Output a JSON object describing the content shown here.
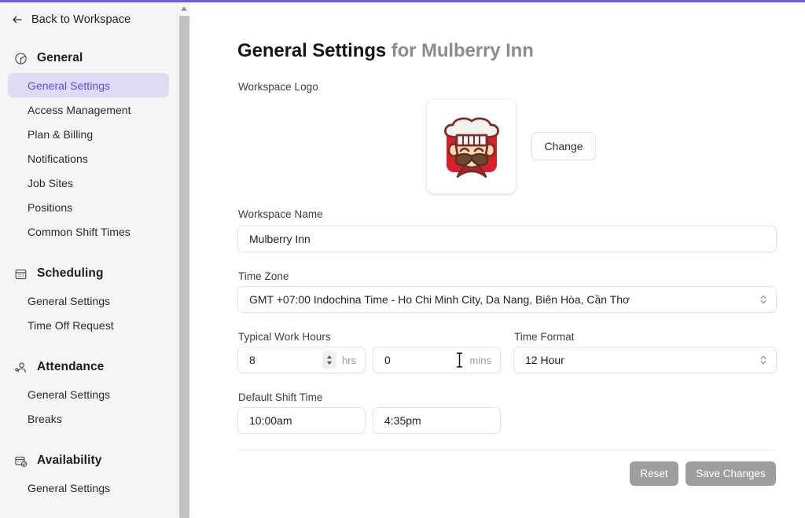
{
  "accent_color": "#6c5ce7",
  "sidebar": {
    "back": {
      "label": "Back to Workspace",
      "icon": "arrow-left-icon"
    },
    "groups": [
      {
        "title": "General",
        "icon": "compass-icon",
        "items": [
          {
            "label": "General Settings",
            "active": true
          },
          {
            "label": "Access Management",
            "active": false
          },
          {
            "label": "Plan & Billing",
            "active": false
          },
          {
            "label": "Notifications",
            "active": false
          },
          {
            "label": "Job Sites",
            "active": false
          },
          {
            "label": "Positions",
            "active": false
          },
          {
            "label": "Common Shift Times",
            "active": false
          }
        ]
      },
      {
        "title": "Scheduling",
        "icon": "calendar-icon",
        "items": [
          {
            "label": "General Settings",
            "active": false
          },
          {
            "label": "Time Off Request",
            "active": false
          }
        ]
      },
      {
        "title": "Attendance",
        "icon": "user-check-icon",
        "items": [
          {
            "label": "General Settings",
            "active": false
          },
          {
            "label": "Breaks",
            "active": false
          }
        ]
      },
      {
        "title": "Availability",
        "icon": "calendar-check-icon",
        "items": [
          {
            "label": "General Settings",
            "active": false
          }
        ]
      }
    ],
    "scrollbar": {
      "up_arrow_icon": "caret-up-icon"
    }
  },
  "main": {
    "title_primary": "General Settings",
    "title_secondary": "for Mulberry Inn",
    "logo": {
      "label": "Workspace Logo",
      "alt": "chef-mascot-logo",
      "change_button": "Change",
      "colors": {
        "background": "#d32229",
        "hat": "#f4f2ef",
        "outline": "#7c2d26",
        "skin": "#f5d9b8",
        "mustache": "#6e4730"
      }
    },
    "workspace_name": {
      "label": "Workspace Name",
      "value": "Mulberry Inn",
      "placeholder": "Workspace Name"
    },
    "time_zone": {
      "label": "Time Zone",
      "value": "GMT +07:00 Indochina Time - Ho Chi Minh City, Da Nang, Biên Hòa, Cần Thơ"
    },
    "typical_work_hours": {
      "label": "Typical Work Hours",
      "hours_value": "8",
      "hours_unit": "hrs",
      "minutes_value": "0",
      "minutes_unit": "mins"
    },
    "time_format": {
      "label": "Time Format",
      "value": "12 Hour"
    },
    "default_shift_time": {
      "label": "Default Shift Time",
      "start_value": "10:00am",
      "end_value": "4:35pm"
    },
    "actions": {
      "reset": "Reset",
      "save": "Save Changes"
    }
  }
}
